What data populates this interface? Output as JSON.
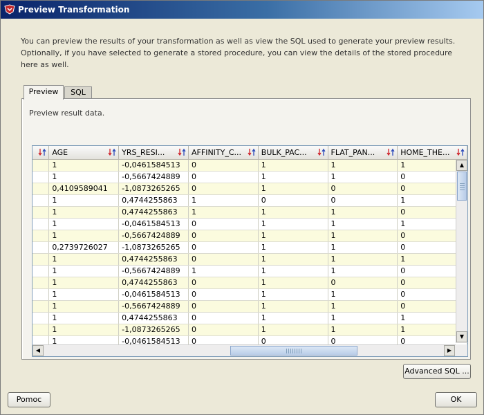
{
  "window": {
    "title": "Preview Transformation",
    "close_glyph": "✕"
  },
  "description": "You can preview the results of your transformation as well as view the SQL used to generate your preview results. Optionally, if you have selected to generate a stored procedure, you can view the details of the stored procedure here as well.",
  "tabs": [
    {
      "label": "Preview",
      "active": true
    },
    {
      "label": "SQL",
      "active": false
    }
  ],
  "panel": {
    "label": "Preview result data."
  },
  "table": {
    "columns": [
      "AGE",
      "YRS_RESI...",
      "AFFINITY_C...",
      "BULK_PAC...",
      "FLAT_PAN...",
      "HOME_THE..."
    ],
    "rows": [
      [
        "1",
        "-0,0461584513",
        "0",
        "1",
        "1",
        "1"
      ],
      [
        "1",
        "-0,5667424889",
        "0",
        "1",
        "1",
        "0"
      ],
      [
        "0,4109589041",
        "-1,0873265265",
        "0",
        "1",
        "0",
        "0"
      ],
      [
        "1",
        "0,4744255863",
        "1",
        "0",
        "0",
        "1"
      ],
      [
        "1",
        "0,4744255863",
        "1",
        "1",
        "1",
        "0"
      ],
      [
        "1",
        "-0,0461584513",
        "0",
        "1",
        "1",
        "1"
      ],
      [
        "1",
        "-0,5667424889",
        "0",
        "1",
        "1",
        "0"
      ],
      [
        "0,2739726027",
        "-1,0873265265",
        "0",
        "1",
        "1",
        "0"
      ],
      [
        "1",
        "0,4744255863",
        "0",
        "1",
        "1",
        "1"
      ],
      [
        "1",
        "-0,5667424889",
        "1",
        "1",
        "1",
        "0"
      ],
      [
        "1",
        "0,4744255863",
        "0",
        "1",
        "0",
        "0"
      ],
      [
        "1",
        "-0,0461584513",
        "0",
        "1",
        "1",
        "0"
      ],
      [
        "1",
        "-0,5667424889",
        "0",
        "1",
        "1",
        "0"
      ],
      [
        "1",
        "0,4744255863",
        "0",
        "1",
        "1",
        "1"
      ],
      [
        "1",
        "-1,0873265265",
        "0",
        "1",
        "1",
        "1"
      ],
      [
        "1",
        "-0,0461584513",
        "0",
        "0",
        "0",
        "0"
      ]
    ]
  },
  "buttons": {
    "advanced_sql": "Advanced SQL ...",
    "help": "Pomoc",
    "ok": "OK"
  },
  "icons": {
    "sort": "sort-arrows-icon",
    "app": "oracle-app-icon"
  },
  "colors": {
    "row_odd": "#fbfbde",
    "row_even": "#ffffff",
    "title_bar": "#0a246a"
  }
}
